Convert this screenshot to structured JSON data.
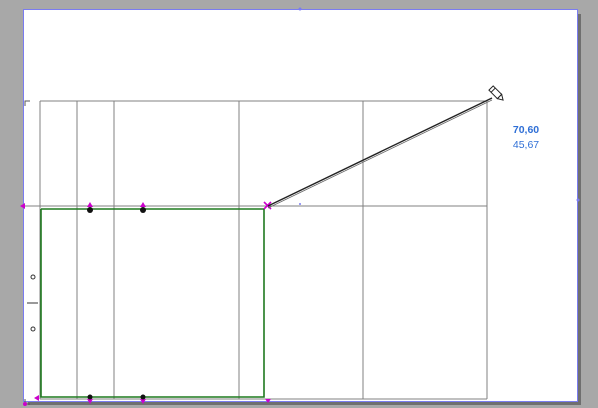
{
  "canvas": {
    "colors": {
      "background": "#a8a8a8",
      "sheet": "#ffffff",
      "sheet_border": "#7a7cf0",
      "grid": "#808080",
      "wall": "#1f7a1f",
      "snap_marker": "#cc00cc",
      "dimension_line": "#222222"
    }
  },
  "coordinate_readout": {
    "primary": "70,60",
    "secondary": "45,67",
    "color": "#2f6fd6"
  },
  "tool": {
    "name": "pencil-cursor-icon"
  }
}
